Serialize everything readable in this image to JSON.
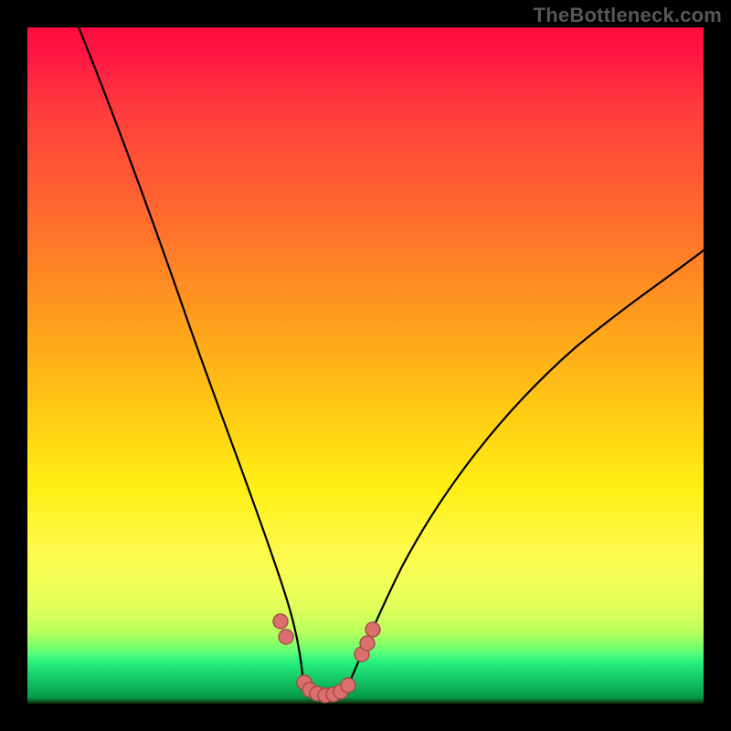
{
  "watermark": "TheBottleneck.com",
  "colors": {
    "page_bg": "#000000",
    "watermark_text": "#575757",
    "curve_stroke": "#000000",
    "marker_fill": "#db6f6e",
    "marker_stroke": "#a54b4a"
  },
  "chart_data": {
    "type": "line",
    "title": "",
    "xlabel": "",
    "ylabel": "",
    "xlim": [
      0,
      100
    ],
    "ylim": [
      0,
      100
    ],
    "note": "No axis ticks, labels, or numeric values are rendered; values are estimated from pixel geometry on a 0-100 plot-area scale (y=100 at top, y=0 at bottom).",
    "series": [
      {
        "name": "left-curve",
        "x": [
          7,
          10,
          14,
          18,
          22,
          26,
          30,
          33,
          35.5,
          37.5,
          39.5,
          40.8
        ],
        "y": [
          100,
          89,
          77,
          66,
          55,
          44,
          33,
          24,
          17,
          11,
          6,
          3
        ]
      },
      {
        "name": "right-curve",
        "x": [
          47.3,
          49,
          51,
          54,
          58,
          63,
          70,
          78,
          88,
          100
        ],
        "y": [
          2.5,
          6,
          10,
          16,
          23,
          31,
          40,
          49,
          58,
          68
        ]
      },
      {
        "name": "valley-floor",
        "x": [
          40.8,
          42.5,
          44.5,
          46.0,
          47.3
        ],
        "y": [
          3,
          1.6,
          1.2,
          1.6,
          2.5
        ]
      }
    ],
    "markers": [
      {
        "x": 37.4,
        "y": 12.2
      },
      {
        "x": 38.2,
        "y": 9.9
      },
      {
        "x": 40.9,
        "y": 3.1
      },
      {
        "x": 41.8,
        "y": 2.0
      },
      {
        "x": 42.9,
        "y": 1.5
      },
      {
        "x": 44.1,
        "y": 1.2
      },
      {
        "x": 45.3,
        "y": 1.4
      },
      {
        "x": 46.4,
        "y": 1.8
      },
      {
        "x": 47.4,
        "y": 2.7
      },
      {
        "x": 49.5,
        "y": 7.3
      },
      {
        "x": 50.2,
        "y": 8.9
      },
      {
        "x": 51.1,
        "y": 11.0
      }
    ]
  }
}
